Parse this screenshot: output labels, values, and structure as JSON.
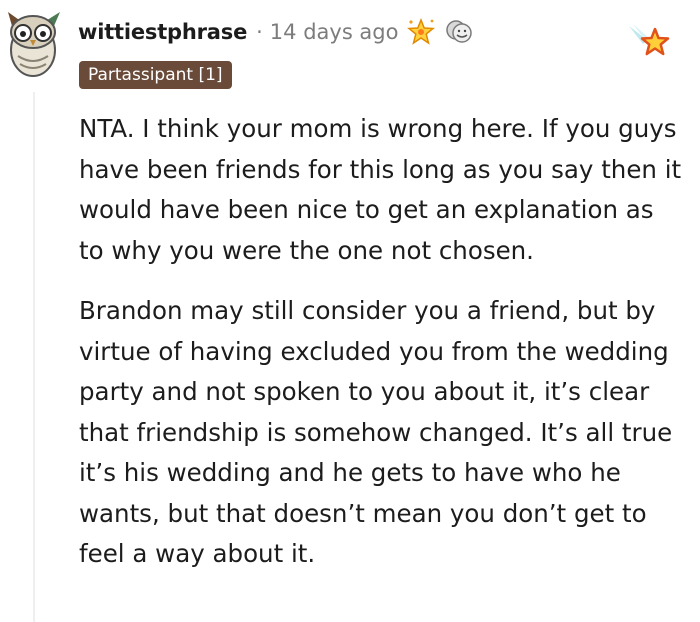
{
  "comment": {
    "username": "wittiestphrase",
    "separator": "·",
    "timestamp": "14 days ago",
    "flair": "Partassipant [1]",
    "awards": [
      "starstruck-award-icon",
      "hug-award-icon",
      "rocket-star-award-icon"
    ],
    "paragraphs": [
      "NTA. I think your mom is wrong here. If you guys have been friends for this long as you say then it would have been nice to get an explanation as to why you were the one not chosen.",
      "Brandon may still consider you a friend, but by virtue of having excluded you from the wedding party and not spoken to you about it, it’s clear that friendship is somehow changed. It’s all true it’s his wedding and he gets to have who he wants, but that doesn’t mean you don’t get to feel a way about it."
    ]
  },
  "colors": {
    "flair_bg": "#6a4b3a",
    "timestamp": "#7c7c7c",
    "thread_line": "#edeff1"
  }
}
